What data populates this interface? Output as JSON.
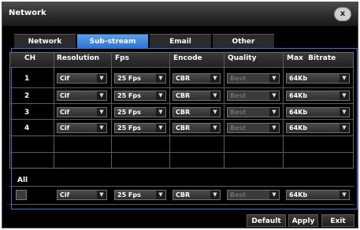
{
  "window": {
    "title": "Network",
    "close_label": "x"
  },
  "tabs": [
    {
      "label": "Network",
      "active": false
    },
    {
      "label": "Sub-stream",
      "active": true
    },
    {
      "label": "Email",
      "active": false
    },
    {
      "label": "Other",
      "active": false
    }
  ],
  "table": {
    "headers": [
      "CH",
      "Resolution",
      "Fps",
      "Encode",
      "Quality",
      "Max  Bitrate"
    ],
    "rows": [
      {
        "ch": "1",
        "resolution": "Cif",
        "fps": "25 Fps",
        "encode": "CBR",
        "quality": "Best",
        "bitrate": "64Kb"
      },
      {
        "ch": "2",
        "resolution": "Cif",
        "fps": "25 Fps",
        "encode": "CBR",
        "quality": "Best",
        "bitrate": "64Kb"
      },
      {
        "ch": "3",
        "resolution": "Cif",
        "fps": "25 Fps",
        "encode": "CBR",
        "quality": "Best",
        "bitrate": "64Kb"
      },
      {
        "ch": "4",
        "resolution": "Cif",
        "fps": "25 Fps",
        "encode": "CBR",
        "quality": "Best",
        "bitrate": "64Kb"
      }
    ]
  },
  "all": {
    "label": "All",
    "resolution": "Cif",
    "fps": "25 Fps",
    "encode": "CBR",
    "quality": "Best",
    "bitrate": "64Kb"
  },
  "buttons": {
    "default": "Default",
    "apply": "Apply",
    "exit": "Exit"
  },
  "colors": {
    "accent": "#2f6fe0",
    "tab_active": "#3d86e0",
    "background": "#000000"
  },
  "arrow_glyph": "▼"
}
